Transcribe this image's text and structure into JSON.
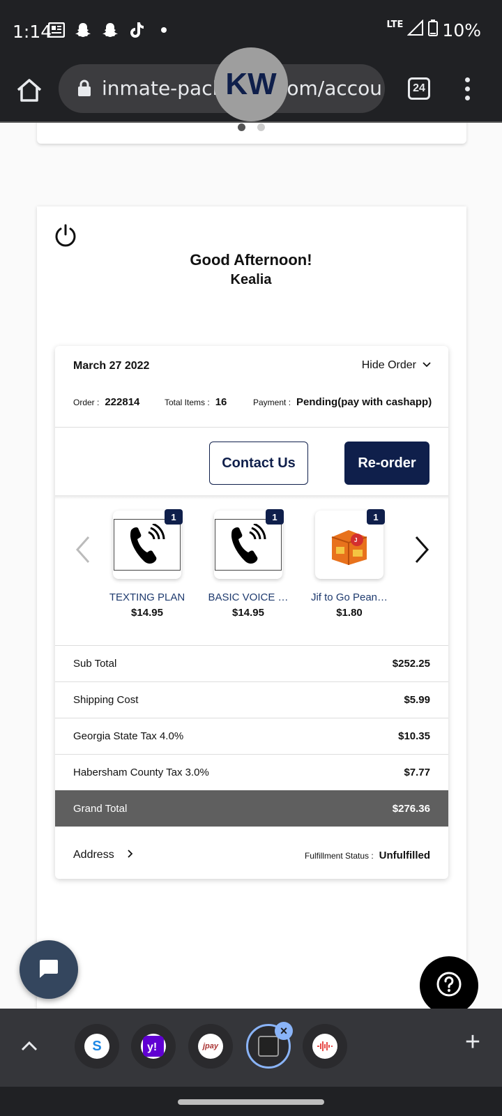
{
  "status_bar": {
    "time": "1:14",
    "network": "LTE",
    "battery": "10%",
    "notification_icons": [
      "news-icon",
      "snapchat-icon",
      "snapchat-icon",
      "tiktok-icon",
      "dot-icon"
    ]
  },
  "browser": {
    "url": "inmate-packages.com/accour",
    "tab_count": "24"
  },
  "profile": {
    "initials": "KW",
    "greeting": "Good Afternoon!",
    "name": "Kealia"
  },
  "order": {
    "date": "March 27 2022",
    "hide_label": "Hide Order",
    "order_label": "Order :",
    "order_number": "222814",
    "items_label": "Total Items :",
    "items_count": "16",
    "payment_label": "Payment :",
    "payment_status": "Pending(pay with cashapp)",
    "contact_button": "Contact Us",
    "reorder_button": "Re-order",
    "products": [
      {
        "name": "TEXTING PLAN",
        "price": "$14.95",
        "qty": "1",
        "icon": "phone-icon"
      },
      {
        "name": "BASIC VOICE …",
        "price": "$14.95",
        "qty": "1",
        "icon": "phone-icon"
      },
      {
        "name": "Jif to Go Pean…",
        "price": "$1.80",
        "qty": "1",
        "icon": "peanut-butter-box-icon"
      }
    ],
    "summary": [
      {
        "label": "Sub Total",
        "value": "$252.25"
      },
      {
        "label": "Shipping Cost",
        "value": "$5.99"
      },
      {
        "label": "Georgia State Tax 4.0%",
        "value": "$10.35"
      },
      {
        "label": "Habersham County Tax 3.0%",
        "value": "$7.77"
      }
    ],
    "grand_total_label": "Grand Total",
    "grand_total_value": "$276.36",
    "address_label": "Address",
    "fulfillment_label": "Fulfillment Status :",
    "fulfillment_status": "Unfulfilled"
  },
  "colors": {
    "brand_navy": "#0f1f4b",
    "grand_total_bg": "#5f5f5f",
    "chrome_dark": "#202124"
  }
}
